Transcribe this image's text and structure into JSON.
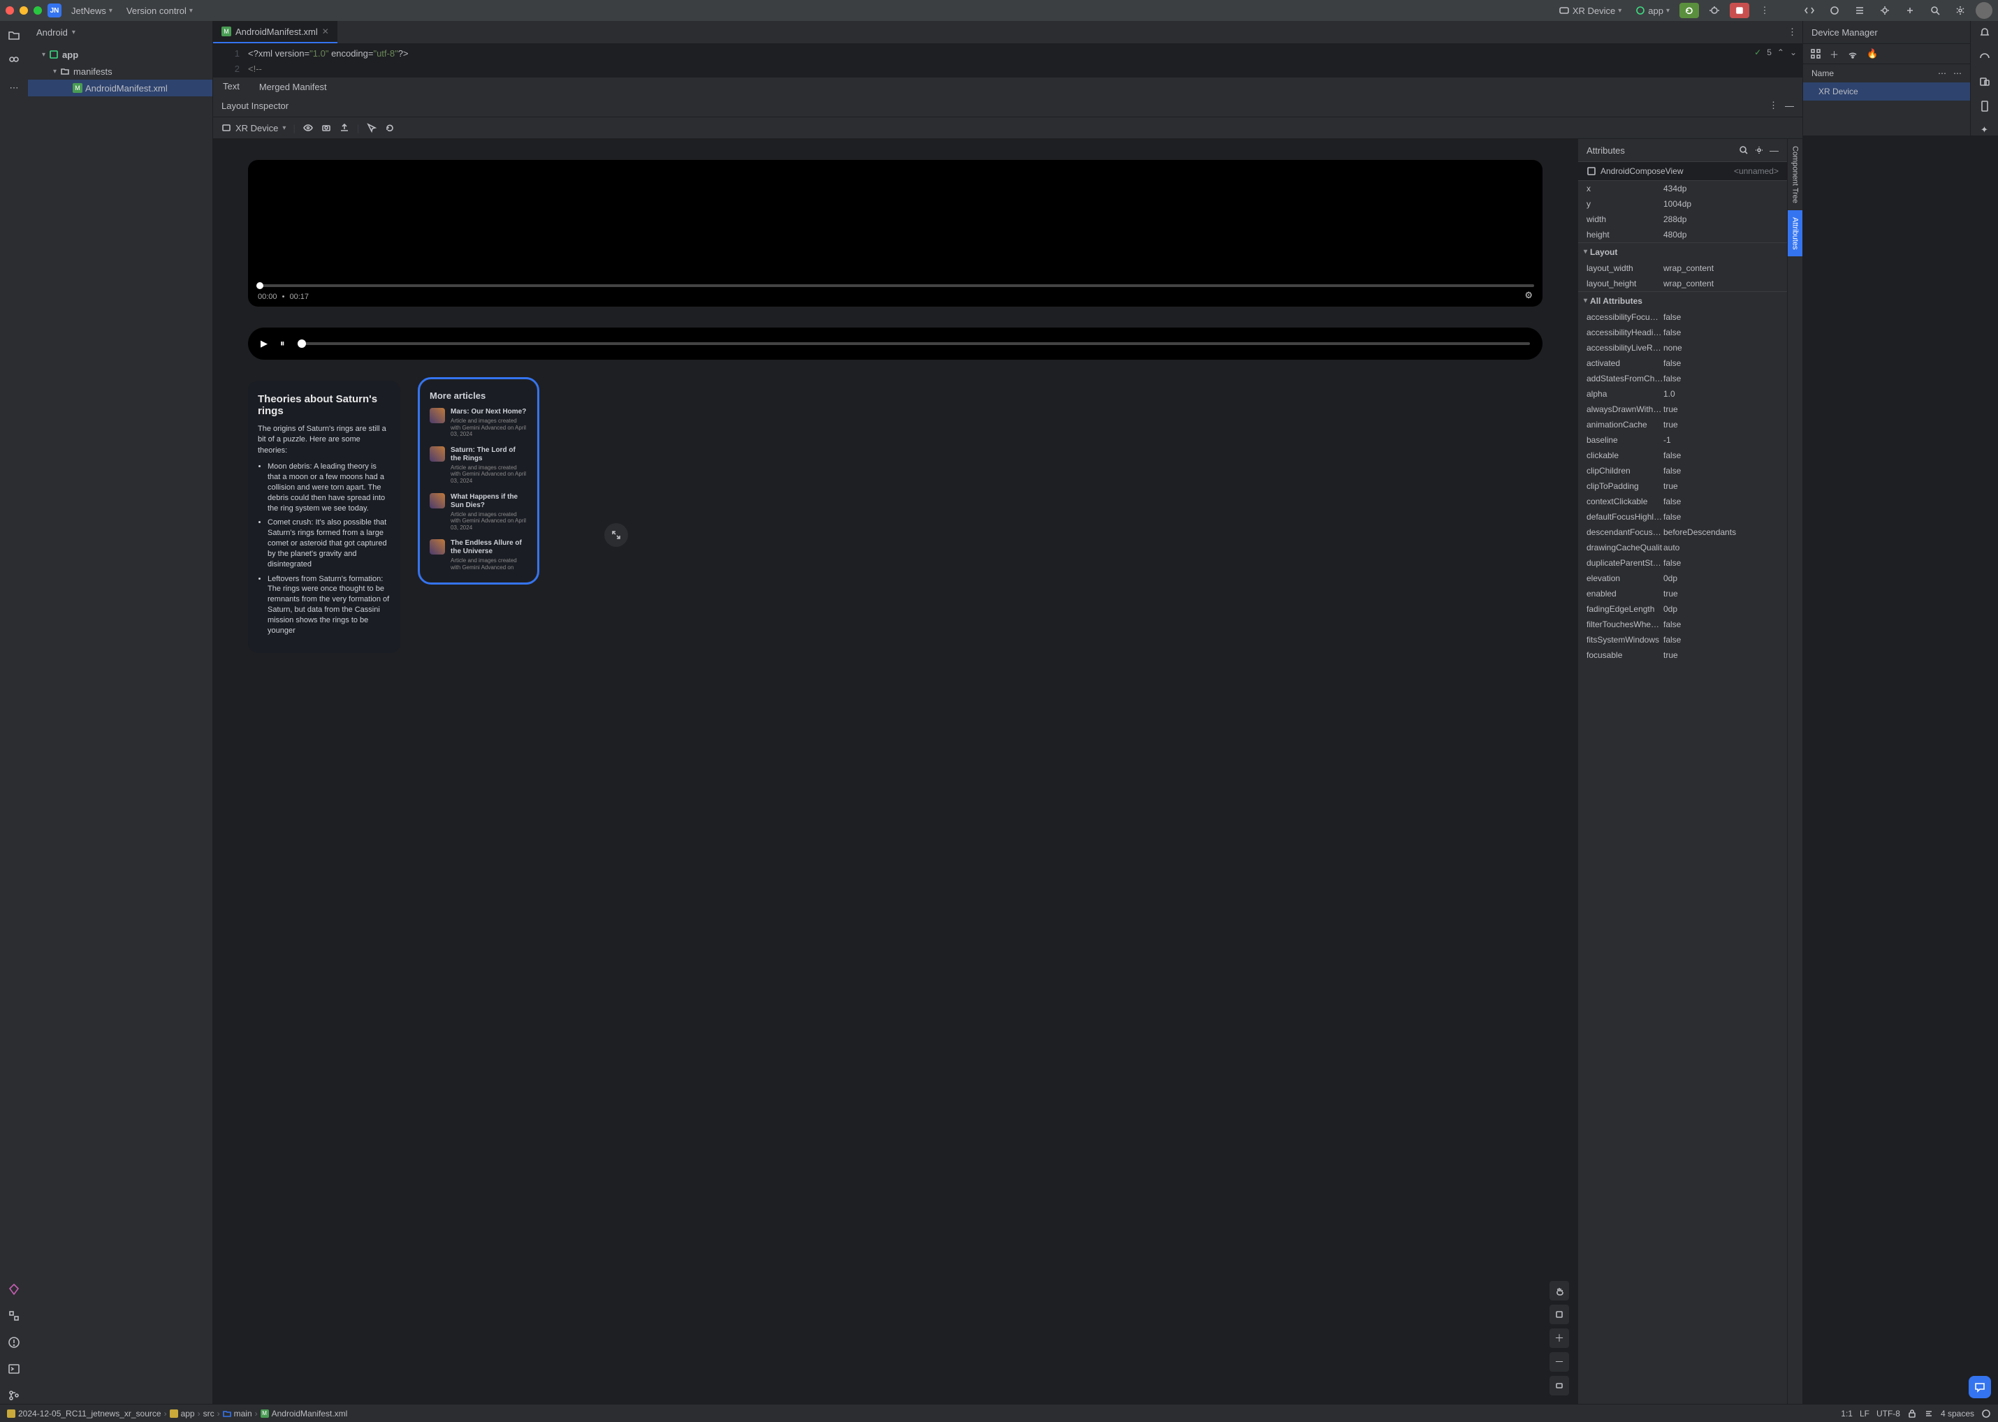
{
  "titlebar": {
    "project_initials": "JN",
    "project_name": "JetNews",
    "vcs_label": "Version control",
    "device_label": "XR Device",
    "run_config": "app"
  },
  "project_panel": {
    "view_label": "Android",
    "tree": {
      "root": "app",
      "manifests": "manifests",
      "manifest_file": "AndroidManifest.xml"
    }
  },
  "editor": {
    "tab_file": "AndroidManifest.xml",
    "warnings_count": "5",
    "line1_prefix": "<?xml version=",
    "line1_v1": "\"1.0\"",
    "line1_mid": " encoding=",
    "line1_v2": "\"utf-8\"",
    "line1_suffix": "?>",
    "line2": "<!--",
    "sub_tabs": {
      "text": "Text",
      "merged": "Merged Manifest"
    },
    "gutter": {
      "l1": "1",
      "l2": "2"
    }
  },
  "inspector": {
    "title": "Layout Inspector",
    "process_label": "XR Device"
  },
  "preview": {
    "video": {
      "current": "00:00",
      "sep": "•",
      "total": "00:17"
    },
    "article": {
      "title": "Theories about Saturn's rings",
      "intro": "The origins of Saturn's rings are still a bit of a puzzle. Here are some theories:",
      "bullets": [
        "Moon debris: A leading theory is that a moon or a few moons had a collision and were torn apart. The debris could then have spread into the ring system we see today.",
        "Comet crush: It's also possible that Saturn's rings formed from a large comet or asteroid that got captured by the planet's gravity and disintegrated",
        "Leftovers from Saturn's formation: The rings were once thought to be remnants from the very formation of Saturn, but data from the Cassini mission shows the rings to be younger"
      ]
    },
    "more": {
      "title": "More articles",
      "items": [
        {
          "title": "Mars: Our Next Home?",
          "sub": "Article and images created with Gemini Advanced on April 03, 2024"
        },
        {
          "title": "Saturn: The Lord of the Rings",
          "sub": "Article and images created with Gemini Advanced on April 03, 2024"
        },
        {
          "title": "What Happens if the Sun Dies?",
          "sub": "Article and images created with Gemini Advanced on April 03, 2024"
        },
        {
          "title": "The Endless Allure of the Universe",
          "sub": "Article and images created with Gemini Advanced on"
        }
      ]
    }
  },
  "attributes": {
    "header": "Attributes",
    "element_type": "AndroidComposeView",
    "element_name": "<unnamed>",
    "basic": [
      {
        "k": "x",
        "v": "434dp"
      },
      {
        "k": "y",
        "v": "1004dp"
      },
      {
        "k": "width",
        "v": "288dp"
      },
      {
        "k": "height",
        "v": "480dp"
      }
    ],
    "layout_label": "Layout",
    "layout": [
      {
        "k": "layout_width",
        "v": "wrap_content"
      },
      {
        "k": "layout_height",
        "v": "wrap_content"
      }
    ],
    "all_label": "All Attributes",
    "all": [
      {
        "k": "accessibilityFocu…",
        "v": "false"
      },
      {
        "k": "accessibilityHeadi…",
        "v": "false"
      },
      {
        "k": "accessibilityLiveR…",
        "v": "none"
      },
      {
        "k": "activated",
        "v": "false"
      },
      {
        "k": "addStatesFromCh…",
        "v": "false"
      },
      {
        "k": "alpha",
        "v": "1.0"
      },
      {
        "k": "alwaysDrawnWith…",
        "v": "true"
      },
      {
        "k": "animationCache",
        "v": "true"
      },
      {
        "k": "baseline",
        "v": "-1"
      },
      {
        "k": "clickable",
        "v": "false"
      },
      {
        "k": "clipChildren",
        "v": "false"
      },
      {
        "k": "clipToPadding",
        "v": "true"
      },
      {
        "k": "contextClickable",
        "v": "false"
      },
      {
        "k": "defaultFocusHighli…",
        "v": "false"
      },
      {
        "k": "descendantFocus…",
        "v": "beforeDescendants"
      },
      {
        "k": "drawingCacheQualit",
        "v": "auto"
      },
      {
        "k": "duplicateParentSt…",
        "v": "false"
      },
      {
        "k": "elevation",
        "v": "0dp"
      },
      {
        "k": "enabled",
        "v": "true"
      },
      {
        "k": "fadingEdgeLength",
        "v": "0dp"
      },
      {
        "k": "filterTouchesWhe…",
        "v": "false"
      },
      {
        "k": "fitsSystemWindows",
        "v": "false"
      },
      {
        "k": "focusable",
        "v": "true"
      }
    ]
  },
  "side_tabs": {
    "tree": "Component Tree",
    "attrs": "Attributes"
  },
  "device_manager": {
    "title": "Device Manager",
    "col_name": "Name",
    "row_device": "XR Device"
  },
  "statusbar": {
    "crumbs": [
      "2024-12-05_RC11_jetnews_xr_source",
      "app",
      "src",
      "main",
      "AndroidManifest.xml"
    ],
    "pos": "1:1",
    "le": "LF",
    "enc": "UTF-8",
    "indent": "4 spaces"
  }
}
